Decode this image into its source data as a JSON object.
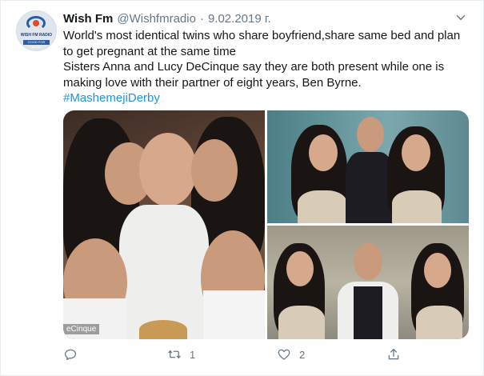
{
  "account": {
    "name": "Wish Fm",
    "handle": "@Wishfmradio",
    "separator": "·",
    "date": "9.02.2019 г.",
    "avatar_text": "WISH FM RADIO",
    "avatar_subtext": "GOOD FOR MUSIC"
  },
  "tweet": {
    "lines": [
      "World's most identical twins who share boyfriend,share same bed and plan",
      "to get pregnant at the same time",
      "Sisters Anna and Lucy DeCinque say they are both present while one is",
      "making love with their partner of eight years, Ben Byrne."
    ],
    "hashtag": "#MashemejiDerby"
  },
  "media": {
    "watermark": "eCinque",
    "images": [
      {
        "name": "photo-twins-kissing"
      },
      {
        "name": "photo-twins-standing"
      },
      {
        "name": "photo-twins-smiling"
      }
    ]
  },
  "actions": {
    "reply_count": "",
    "retweet_count": "1",
    "like_count": "2",
    "icons": [
      "reply-icon",
      "retweet-icon",
      "like-icon",
      "share-icon"
    ]
  },
  "colors": {
    "text": "#14171a",
    "secondary": "#657786",
    "link": "#1b95e0",
    "border": "#e6ecf0"
  }
}
